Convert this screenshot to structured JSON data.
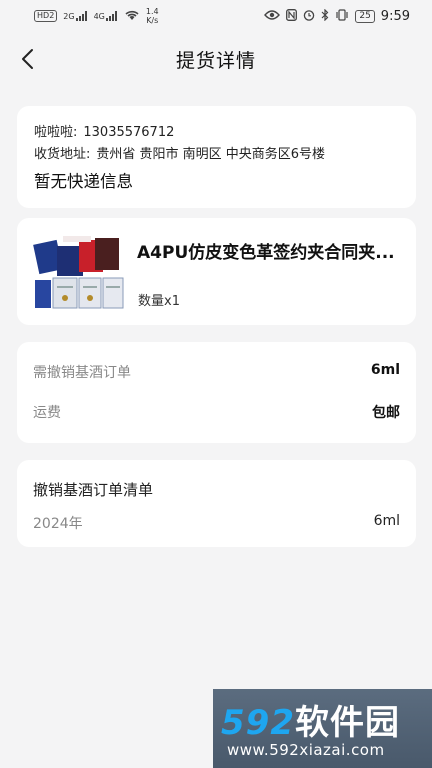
{
  "status_bar": {
    "hd_badge": "HD",
    "hd_num": "2",
    "net1": "2G",
    "net2": "4G",
    "speed_value": "1.4",
    "speed_unit": "K/s",
    "battery": "25",
    "time": "9:59"
  },
  "header": {
    "title": "提货详情"
  },
  "address": {
    "contact_name": "啦啦啦:",
    "contact_phone": "13035576712",
    "address_label": "收货地址:",
    "address_value": "贵州省 贵阳市 南明区 中央商务区6号楼",
    "express_status": "暂无快递信息"
  },
  "goods": {
    "name": "A4PU仿皮变色革签约夹合同夹...",
    "quantity": "数量x1"
  },
  "fees": {
    "need_label": "需撤销基酒订单",
    "need_value": "6ml",
    "shipping_label": "运费",
    "shipping_value": "包邮"
  },
  "order_list": {
    "title": "撤销基酒订单清单",
    "year": "2024年",
    "amount": "6ml"
  },
  "watermark": {
    "logo_num": "592",
    "logo_text": "软件园",
    "url": "www.592xiazai.com"
  }
}
